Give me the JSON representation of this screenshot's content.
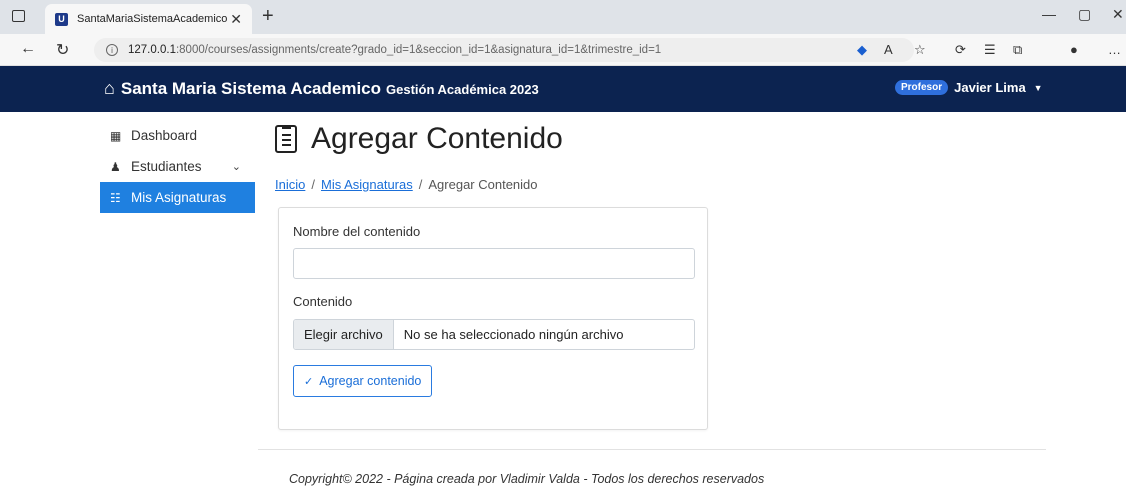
{
  "browser": {
    "tab_title": "SantaMariaSistemaAcademico",
    "tab_favicon_letter": "U",
    "url_host": "127.0.0.1",
    "url_path": ":8000/courses/assignments/create?grado_id=1&seccion_id=1&asignatura_id=1&trimestre_id=1"
  },
  "navbar": {
    "brand": "Santa Maria Sistema Academico",
    "subtitle": "Gestión Académica 2023",
    "role_badge": "Profesor",
    "user_name": "Javier Lima"
  },
  "sidebar": {
    "items": [
      {
        "label": "Dashboard",
        "icon": "grid-icon",
        "active": false
      },
      {
        "label": "Estudiantes",
        "icon": "users-icon",
        "active": false
      },
      {
        "label": "Mis Asignaturas",
        "icon": "list-icon",
        "active": true
      }
    ]
  },
  "main": {
    "title": "Agregar Contenido",
    "breadcrumb": {
      "home": "Inicio",
      "parent": "Mis Asignaturas",
      "current": "Agregar Contenido"
    },
    "form": {
      "name_label": "Nombre del contenido",
      "name_value": "",
      "content_label": "Contenido",
      "file_button": "Elegir archivo",
      "file_status": "No se ha seleccionado ningún archivo",
      "submit_label": "Agregar contenido"
    }
  },
  "footer": {
    "text": "Copyright© 2022 - Página creada por Vladimir Valda - Todos los derechos reservados"
  },
  "colors": {
    "navbar_bg": "#0c2350",
    "accent": "#1f80e0",
    "badge": "#2f6fdc"
  }
}
